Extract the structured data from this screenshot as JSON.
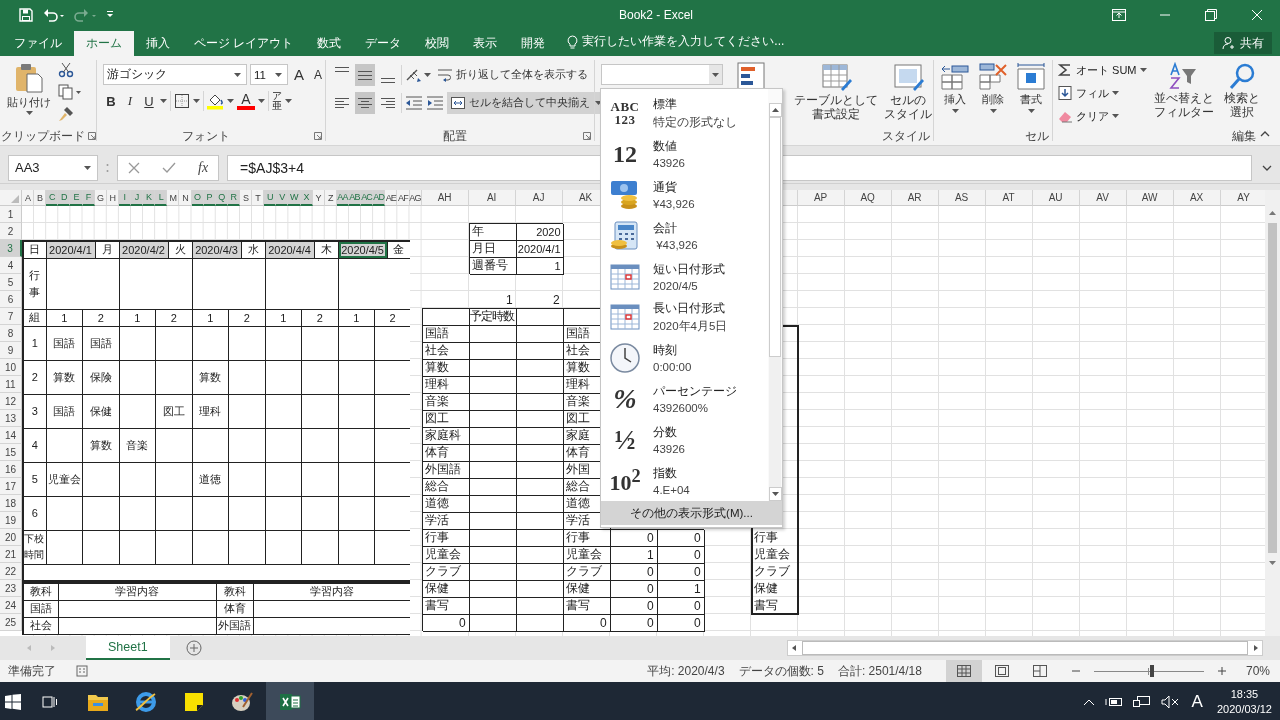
{
  "title_bar": {
    "title": "Book2 - Excel",
    "quick_access": [
      {
        "kind": "save",
        "disabled": false
      },
      {
        "kind": "undo",
        "disabled": false
      },
      {
        "kind": "redo",
        "disabled": true
      },
      {
        "kind": "customize",
        "disabled": false
      }
    ]
  },
  "tabs": [
    {
      "label": "ファイル",
      "selected": false
    },
    {
      "label": "ホーム",
      "selected": true
    },
    {
      "label": "挿入",
      "selected": false
    },
    {
      "label": "ページ レイアウト",
      "selected": false
    },
    {
      "label": "数式",
      "selected": false
    },
    {
      "label": "データ",
      "selected": false
    },
    {
      "label": "校閲",
      "selected": false
    },
    {
      "label": "表示",
      "selected": false
    },
    {
      "label": "開発",
      "selected": false
    }
  ],
  "tell_me": {
    "text": "実行したい作業を入力してください..."
  },
  "share": {
    "label": "共有"
  },
  "ribbon": {
    "clipboard": {
      "label": "クリップボード",
      "paste": "貼り付け"
    },
    "font": {
      "label": "フォント",
      "name": "游ゴシック",
      "size": "11",
      "size_buttons": [
        {
          "kind": "grow",
          "glyph": "A"
        },
        {
          "kind": "shrink",
          "glyph": "A"
        }
      ],
      "style_buttons": [
        {
          "kind": "bold",
          "glyph": "B"
        },
        {
          "kind": "italic",
          "glyph": "I"
        },
        {
          "kind": "underline",
          "glyph": "U"
        }
      ],
      "color_buttons": [
        {
          "kind": "fill",
          "color": "#ffff00"
        },
        {
          "kind": "font-color",
          "glyph": "A",
          "color": "#ff0000"
        }
      ],
      "phonetic": {
        "top": "ア",
        "glyph": "亜"
      }
    },
    "alignment": {
      "label": "配置",
      "vertical": [
        {
          "kind": "top",
          "selected": false
        },
        {
          "kind": "middle",
          "selected": true
        },
        {
          "kind": "bottom",
          "selected": false
        }
      ],
      "horizontal": [
        {
          "kind": "left",
          "selected": false
        },
        {
          "kind": "center",
          "selected": true
        },
        {
          "kind": "right",
          "selected": false
        }
      ],
      "wrap": {
        "label": "折り返して全体を表示する"
      },
      "merge": {
        "label": "セルを結合して中央揃え",
        "selected": true
      }
    },
    "styles": {
      "label": "スタイル",
      "buttons": [
        {
          "kind": "table",
          "lines": [
            "テーブルとして",
            "書式設定"
          ]
        },
        {
          "kind": "cell-style",
          "lines": [
            "セルの",
            "スタイル"
          ]
        }
      ]
    },
    "cells": {
      "label": "セル",
      "buttons": [
        {
          "kind": "insert",
          "label": "挿入"
        },
        {
          "kind": "delete",
          "label": "削除"
        },
        {
          "kind": "format",
          "label": "書式"
        }
      ]
    },
    "editing": {
      "label": "編集",
      "small": [
        {
          "kind": "autosum",
          "label": "オート SUM"
        },
        {
          "kind": "fill",
          "label": "フィル"
        },
        {
          "kind": "clear",
          "label": "クリア"
        }
      ],
      "large": [
        {
          "kind": "sort",
          "lines": [
            "並べ替えと",
            "フィルター"
          ]
        },
        {
          "kind": "find",
          "lines": [
            "検索と",
            "選択"
          ]
        }
      ]
    }
  },
  "number_format_menu": {
    "items": [
      {
        "kind": "general",
        "glyph": [
          "ABC",
          "123"
        ],
        "name": "標準",
        "sample": "特定の形式なし"
      },
      {
        "kind": "number",
        "glyph": [
          "12"
        ],
        "name": "数値",
        "sample": "43926"
      },
      {
        "kind": "currency",
        "name": "通貨",
        "sample": "¥43,926"
      },
      {
        "kind": "accounting",
        "name": "会計",
        "sample": " ¥43,926"
      },
      {
        "kind": "short-date",
        "name": "短い日付形式",
        "sample": "2020/4/5"
      },
      {
        "kind": "long-date",
        "name": "長い日付形式",
        "sample": "2020年4月5日"
      },
      {
        "kind": "time",
        "name": "時刻",
        "sample": "0:00:00"
      },
      {
        "kind": "percent",
        "glyph": [
          "%"
        ],
        "name": "パーセンテージ",
        "sample": "4392600%"
      },
      {
        "kind": "fraction",
        "glyph": [
          "½"
        ],
        "name": "分数",
        "sample": "43926"
      },
      {
        "kind": "scientific",
        "glyph": [
          "10$^{2}$"
        ],
        "name": "指数",
        "sample": "4.E+04"
      }
    ],
    "more": "その他の表示形式(M)..."
  },
  "formula_bar": {
    "name_box": "AA3",
    "fx": "fx",
    "formula": "=$AJ$3+4"
  },
  "sheet": {
    "narrow_columns": [
      {
        "label": "A",
        "selected": false
      },
      {
        "label": "B",
        "selected": false
      },
      {
        "label": "C",
        "selected": true
      },
      {
        "label": "D",
        "selected": true
      },
      {
        "label": "E",
        "selected": true
      },
      {
        "label": "F",
        "selected": true
      },
      {
        "label": "G",
        "selected": false
      },
      {
        "label": "H",
        "selected": false
      },
      {
        "label": "I",
        "selected": true
      },
      {
        "label": "J",
        "selected": true
      },
      {
        "label": "K",
        "selected": true
      },
      {
        "label": "L",
        "selected": true
      },
      {
        "label": "M",
        "selected": false
      },
      {
        "label": "N",
        "selected": false
      },
      {
        "label": "O",
        "selected": true
      },
      {
        "label": "P",
        "selected": true
      },
      {
        "label": "Q",
        "selected": true
      },
      {
        "label": "R",
        "selected": true
      },
      {
        "label": "S",
        "selected": false
      },
      {
        "label": "T",
        "selected": false
      },
      {
        "label": "U",
        "selected": true
      },
      {
        "label": "V",
        "selected": true
      },
      {
        "label": "W",
        "selected": true
      },
      {
        "label": "X",
        "selected": true
      },
      {
        "label": "Y",
        "selected": false
      },
      {
        "label": "Z",
        "selected": false
      },
      {
        "label": "AA",
        "selected": true
      },
      {
        "label": "AB",
        "selected": true
      },
      {
        "label": "AC",
        "selected": true
      },
      {
        "label": "AD",
        "selected": true
      },
      {
        "label": "AE",
        "selected": false
      },
      {
        "label": "AF",
        "selected": false
      },
      {
        "label": "AG",
        "selected": false
      }
    ],
    "wide_columns_left": [
      "AH",
      "AI",
      "AJ",
      "AK"
    ],
    "wide_columns_right": [
      "AP",
      "AQ",
      "AR",
      "AS",
      "AT",
      "AU",
      "AV",
      "AW",
      "AX",
      "AY"
    ],
    "rows": [
      {
        "label": "1",
        "selected": false
      },
      {
        "label": "2",
        "selected": false
      },
      {
        "label": "3",
        "selected": true
      },
      {
        "label": "4",
        "selected": false
      },
      {
        "label": "5",
        "selected": false
      },
      {
        "label": "6",
        "selected": false
      },
      {
        "label": "7",
        "selected": false
      },
      {
        "label": "8",
        "selected": false
      },
      {
        "label": "9",
        "selected": false
      },
      {
        "label": "10",
        "selected": false
      },
      {
        "label": "11",
        "selected": false
      },
      {
        "label": "12",
        "selected": false
      },
      {
        "label": "13",
        "selected": false
      },
      {
        "label": "14",
        "selected": false
      },
      {
        "label": "15",
        "selected": false
      },
      {
        "label": "16",
        "selected": false
      },
      {
        "label": "17",
        "selected": false
      },
      {
        "label": "18",
        "selected": false
      },
      {
        "label": "19",
        "selected": false
      },
      {
        "label": "20",
        "selected": false
      },
      {
        "label": "21",
        "selected": false
      },
      {
        "label": "22",
        "selected": false
      },
      {
        "label": "23",
        "selected": false
      },
      {
        "label": "24",
        "selected": false
      },
      {
        "label": "25",
        "selected": false
      }
    ],
    "schedule": {
      "day_label": "日",
      "days": [
        {
          "date": "2020/4/1",
          "weekday": "月",
          "selected": true,
          "active": false
        },
        {
          "date": "2020/4/2",
          "weekday": "火",
          "selected": true,
          "active": false
        },
        {
          "date": "2020/4/3",
          "weekday": "水",
          "selected": true,
          "active": false
        },
        {
          "date": "2020/4/4",
          "weekday": "木",
          "selected": true,
          "active": false
        },
        {
          "date": "2020/4/5",
          "weekday": "金",
          "selected": true,
          "active": true
        }
      ],
      "event_label": "行事",
      "class_label": "組",
      "classes": [
        "1",
        "2",
        "1",
        "2",
        "1",
        "2",
        "1",
        "2",
        "1",
        "2"
      ],
      "periods": [
        {
          "label": "1",
          "slots": [
            {
              "kind": "lesson",
              "subject": "国語"
            },
            {
              "kind": "lesson",
              "subject": "国語"
            },
            {
              "kind": "empty"
            },
            {
              "kind": "empty"
            },
            {
              "kind": "empty"
            },
            {
              "kind": "empty"
            },
            {
              "kind": "empty"
            },
            {
              "kind": "empty"
            },
            {
              "kind": "empty"
            },
            {
              "kind": "empty"
            }
          ]
        },
        {
          "label": "2",
          "slots": [
            {
              "kind": "lesson",
              "subject": "算数"
            },
            {
              "kind": "lesson",
              "subject": "保険"
            },
            {
              "kind": "empty"
            },
            {
              "kind": "empty"
            },
            {
              "kind": "lesson",
              "subject": "算数"
            },
            {
              "kind": "empty"
            },
            {
              "kind": "empty"
            },
            {
              "kind": "empty"
            },
            {
              "kind": "empty"
            },
            {
              "kind": "empty"
            }
          ]
        },
        {
          "label": "3",
          "slots": [
            {
              "kind": "lesson",
              "subject": "国語"
            },
            {
              "kind": "lesson",
              "subject": "保健"
            },
            {
              "kind": "empty"
            },
            {
              "kind": "lesson",
              "subject": "図工"
            },
            {
              "kind": "lesson",
              "subject": "理科"
            },
            {
              "kind": "empty"
            },
            {
              "kind": "empty"
            },
            {
              "kind": "empty"
            },
            {
              "kind": "empty"
            },
            {
              "kind": "empty"
            }
          ]
        },
        {
          "label": "4",
          "slots": [
            {
              "kind": "empty"
            },
            {
              "kind": "lesson",
              "subject": "算数"
            },
            {
              "kind": "lesson",
              "subject": "音楽"
            },
            {
              "kind": "empty"
            },
            {
              "kind": "empty"
            },
            {
              "kind": "empty"
            },
            {
              "kind": "empty"
            },
            {
              "kind": "empty"
            },
            {
              "kind": "empty"
            },
            {
              "kind": "empty"
            }
          ]
        },
        {
          "label": "5",
          "slots": [
            {
              "kind": "lesson",
              "subject": "児童会"
            },
            {
              "kind": "empty"
            },
            {
              "kind": "empty"
            },
            {
              "kind": "empty"
            },
            {
              "kind": "lesson",
              "subject": "道徳"
            },
            {
              "kind": "empty"
            },
            {
              "kind": "empty"
            },
            {
              "kind": "empty"
            },
            {
              "kind": "empty"
            },
            {
              "kind": "empty"
            }
          ]
        },
        {
          "label": "6",
          "slots": [
            {
              "kind": "empty"
            },
            {
              "kind": "empty"
            },
            {
              "kind": "empty"
            },
            {
              "kind": "empty"
            },
            {
              "kind": "empty"
            },
            {
              "kind": "empty"
            },
            {
              "kind": "empty"
            },
            {
              "kind": "empty"
            },
            {
              "kind": "empty"
            },
            {
              "kind": "empty"
            }
          ]
        }
      ],
      "dismissal_label": "下校時間"
    },
    "study_table": {
      "headers": [
        "教科",
        "学習内容",
        "教科",
        "学習内容"
      ],
      "rows": [
        [
          "国語",
          "体育"
        ],
        [
          "社会",
          "外国語"
        ]
      ]
    },
    "info_table": [
      {
        "label": "年",
        "value": "2020"
      },
      {
        "label": "月日",
        "value": "2020/4/1"
      },
      {
        "label": "週番号",
        "value": "1"
      }
    ],
    "week_numbers": [
      "1",
      "2"
    ],
    "plan_table": {
      "header": "予定時数",
      "subjects": [
        "国語",
        "社会",
        "算数",
        "理科",
        "音楽",
        "図工",
        "家庭科",
        "体育",
        "外国語",
        "総合",
        "道徳",
        "学活",
        "行事",
        "児童会",
        "クラブ",
        "保健",
        "書写"
      ],
      "total": "0"
    },
    "tally_table": {
      "rows": [
        {
          "subject": "国語"
        },
        {
          "subject": "社会"
        },
        {
          "subject": "算数"
        },
        {
          "subject": "理科"
        },
        {
          "subject": "音楽"
        },
        {
          "subject": "図工"
        },
        {
          "subject": "家庭"
        },
        {
          "subject": "体育"
        },
        {
          "subject": "外国"
        },
        {
          "subject": "総合"
        },
        {
          "subject": "道徳"
        },
        {
          "subject": "学活"
        },
        {
          "subject": "行事",
          "counts": [
            "0",
            "0"
          ]
        },
        {
          "subject": "児童会",
          "counts": [
            "1",
            "0"
          ]
        },
        {
          "subject": "クラブ",
          "counts": [
            "0",
            "0"
          ]
        },
        {
          "subject": "保健",
          "counts": [
            "0",
            "1"
          ]
        },
        {
          "subject": "書写",
          "counts": [
            "0",
            "0"
          ]
        }
      ],
      "totals": [
        "0",
        "0",
        "0"
      ]
    },
    "subject_list": [
      "行事",
      "児童会",
      "クラブ",
      "保健",
      "書写"
    ]
  },
  "sheet_tabs": [
    {
      "label": "Sheet1",
      "selected": true
    }
  ],
  "status_bar": {
    "status": "準備完了",
    "average": "平均: 2020/4/3",
    "count": "データの個数: 5",
    "sum": "合計: 2501/4/18",
    "views": [
      {
        "kind": "normal",
        "selected": true
      },
      {
        "kind": "page-layout",
        "selected": false
      },
      {
        "kind": "page-break",
        "selected": false
      }
    ],
    "zoom": {
      "level": 0.53,
      "reading": "70%"
    }
  },
  "taskbar": {
    "apps": [
      {
        "kind": "task-view",
        "active": false
      },
      {
        "kind": "explorer",
        "active": false
      },
      {
        "kind": "browser",
        "active": false
      },
      {
        "kind": "notes",
        "active": false
      },
      {
        "kind": "paint",
        "active": false
      },
      {
        "kind": "excel",
        "active": true
      }
    ],
    "ime": "A",
    "time": "18:35",
    "date": "2020/03/12"
  }
}
